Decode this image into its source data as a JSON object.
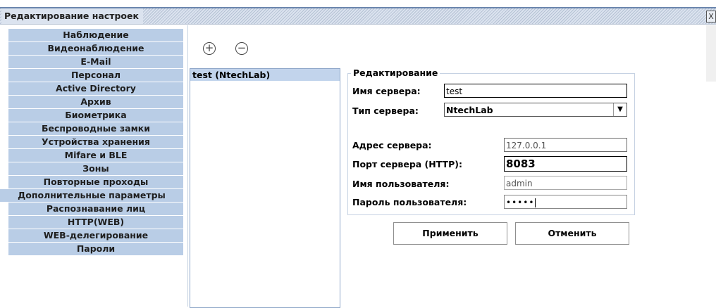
{
  "window": {
    "title": "Редактирование настроек",
    "close_glyph": "X"
  },
  "menu": {
    "items": [
      "Наблюдение",
      "Видеонаблюдение",
      "E-Mail",
      "Персонал",
      "Active Directory",
      "Архив",
      "Биометрика",
      "Беспроводные замки",
      "Устройства хранения",
      "Mifare и BLE",
      "Зоны",
      "Повторные проходы",
      "Дополнительные параметры",
      "Распознавание лиц",
      "HTTP(WEB)",
      "WEB-делегирование",
      "Пароли"
    ]
  },
  "toolbar": {
    "add_icon": "plus-circle-icon",
    "add_glyph": "+",
    "remove_icon": "minus-circle-icon",
    "remove_glyph": "−"
  },
  "servers": {
    "items": [
      "test (NtechLab)"
    ]
  },
  "edit": {
    "legend": "Редактирование",
    "server_name_label": "Имя сервера:",
    "server_name_value": "test",
    "server_type_label": "Тип сервера:",
    "server_type_value": "NtechLab",
    "server_address_label": "Адрес сервера:",
    "server_address_value": "127.0.0.1",
    "server_port_label": "Порт сервера (HTTP):",
    "server_port_value": "8083",
    "username_label": "Имя пользователя:",
    "username_value": "admin",
    "password_label": "Пароль пользователя:",
    "password_value": "•••••"
  },
  "buttons": {
    "apply": "Применить",
    "cancel": "Отменить"
  }
}
